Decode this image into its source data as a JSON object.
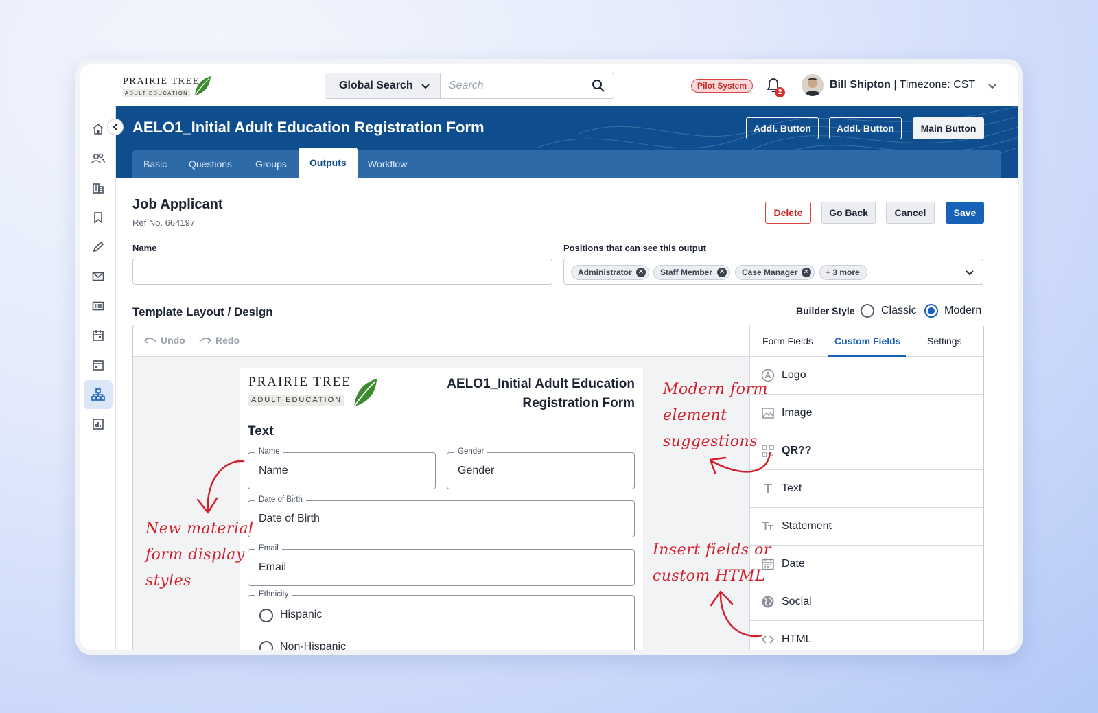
{
  "topbar": {
    "logo_line1": "PRAIRIE TREE",
    "logo_line2": "ADULT EDUCATION",
    "search_select": "Global Search",
    "search_placeholder": "Search",
    "pilot_badge": "Pilot System",
    "notification_count": "2",
    "user_name": "Bill Shipton",
    "user_separator": " | ",
    "timezone": "Timezone: CST"
  },
  "header": {
    "title": "AELO1_Initial Adult Education Registration Form",
    "buttons": [
      "Addl. Button",
      "Addl. Button",
      "Main Button"
    ],
    "tabs": [
      "Basic",
      "Questions",
      "Groups",
      "Outputs",
      "Workflow"
    ],
    "active_tab": "Outputs"
  },
  "page": {
    "heading": "Job Applicant",
    "ref": "Ref No. 664197",
    "actions": {
      "delete": "Delete",
      "go_back": "Go Back",
      "cancel": "Cancel",
      "save": "Save"
    },
    "name_label": "Name",
    "name_value": "",
    "positions_label": "Positions that can see this output",
    "positions": [
      "Administrator",
      "Staff Member",
      "Case Manager"
    ],
    "positions_more": "+ 3 more",
    "template_heading": "Template Layout / Design",
    "builder_style_label": "Builder Style",
    "builder_style_options": [
      "Classic",
      "Modern"
    ],
    "builder_style_selected": "Modern"
  },
  "builder": {
    "undo": "Undo",
    "redo": "Redo",
    "preview": {
      "logo_line1": "PRAIRIE TREE",
      "logo_line2": "ADULT EDUCATION",
      "title": "AELO1_Initial Adult Education Registration Form",
      "section": "Text",
      "fields": {
        "name": {
          "label": "Name",
          "value": "Name"
        },
        "gender": {
          "label": "Gender",
          "value": "Gender"
        },
        "dob": {
          "label": "Date of Birth",
          "value": "Date of Birth"
        },
        "email": {
          "label": "Email",
          "value": "Email"
        },
        "ethnicity": {
          "label": "Ethnicity",
          "options": [
            "Hispanic",
            "Non-Hispanic"
          ]
        }
      }
    },
    "panel_tabs": [
      "Form Fields",
      "Custom Fields",
      "Settings"
    ],
    "panel_active_tab": "Custom Fields",
    "custom_fields": [
      {
        "label": "Logo",
        "icon": "logo-icon"
      },
      {
        "label": "Image",
        "icon": "image-icon"
      },
      {
        "label": "QR??",
        "icon": "qr-icon"
      },
      {
        "label": "Text",
        "icon": "text-icon"
      },
      {
        "label": "Statement",
        "icon": "statement-icon"
      },
      {
        "label": "Date",
        "icon": "calendar-icon"
      },
      {
        "label": "Social",
        "icon": "globe-icon"
      },
      {
        "label": "HTML",
        "icon": "code-icon"
      }
    ]
  },
  "annotations": {
    "left_1": "New material",
    "left_2": "form display",
    "left_3": "styles",
    "right_top_1": "Modern form",
    "right_top_2": "element",
    "right_top_3": "suggestions",
    "right_bottom_1": "Insert fields or",
    "right_bottom_2": "custom HTML"
  },
  "colors": {
    "brand_blue": "#0e4e8f",
    "accent_blue": "#1761b8",
    "danger": "#c62828",
    "annotation_red": "#d21f2b",
    "leaf_green": "#3d8b2f"
  }
}
